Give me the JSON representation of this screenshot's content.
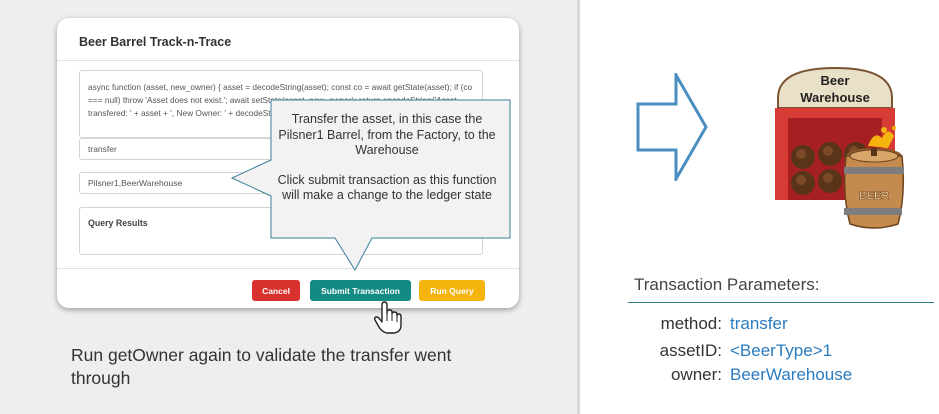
{
  "app": {
    "title": "Beer Barrel Track-n-Trace",
    "function_code": "async function (asset, new_owner) { asset = decodeString(asset); const co = await getState(asset); if (co === null) throw 'Asset does not exist.'; await setState(asset, new_owner); return encodeString('Asset transfered: ' + asset + ', New Owner: ' + decodeString(new_owner)); }",
    "method_value": "transfer",
    "args_value": "Pilsner1,BeerWarehouse",
    "results_label": "Query Results",
    "cancel_label": "Cancel",
    "submit_label": "Submit Transaction",
    "run_query_label": "Run Query"
  },
  "callout": {
    "line1": "Transfer the asset, in this case the Pilsner1 Barrel, from the Factory, to the Warehouse",
    "line2": "Click submit transaction as this function will make a change to the ledger state"
  },
  "caption": "Run getOwner again to validate the transfer went through",
  "warehouse": {
    "sign_line1": "Beer",
    "sign_line2": "Warehouse",
    "barrel_label": "BEER"
  },
  "params": {
    "title": "Transaction Parameters:",
    "rows": [
      {
        "key": "method:",
        "value": "transfer"
      },
      {
        "key": "assetID:",
        "value": "<BeerType>1"
      },
      {
        "key": "owner:",
        "value": "BeerWarehouse"
      }
    ]
  },
  "colors": {
    "cancel": "#d9322e",
    "submit": "#138a83",
    "run_query": "#f5b30e",
    "param_value": "#2a7bbf",
    "arrow": "#4a8ec0"
  },
  "icons": [
    "pointing-hand-cursor-icon",
    "right-arrow-icon",
    "beer-warehouse-icon"
  ]
}
